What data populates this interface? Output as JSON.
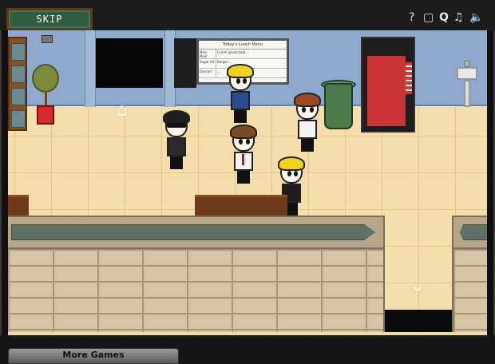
{
  "toolbar": {
    "skip_label": "SKIP",
    "controls": {
      "help": "?",
      "quality_box": "▢",
      "quality": "Q",
      "music": "♫",
      "sound": "🔈"
    }
  },
  "scene": {
    "menu_board": {
      "title": "Today's Lunch Menu",
      "rows": [
        {
          "label": "Main Meal",
          "text": "Lorem ipsum text..."
        },
        {
          "label": "Sugar Alt",
          "text": "Burger ..."
        },
        {
          "label": "Dessert",
          "text": "..."
        }
      ]
    },
    "arrows": {
      "up": "⌂",
      "down": "⌄"
    },
    "colors": {
      "wall": "#8ea9cb",
      "floor": "#f3deac",
      "skip_button": "#2f5b3e",
      "counter_inset": "#5d7167"
    }
  },
  "footer": {
    "more_games_label": "More Games"
  }
}
